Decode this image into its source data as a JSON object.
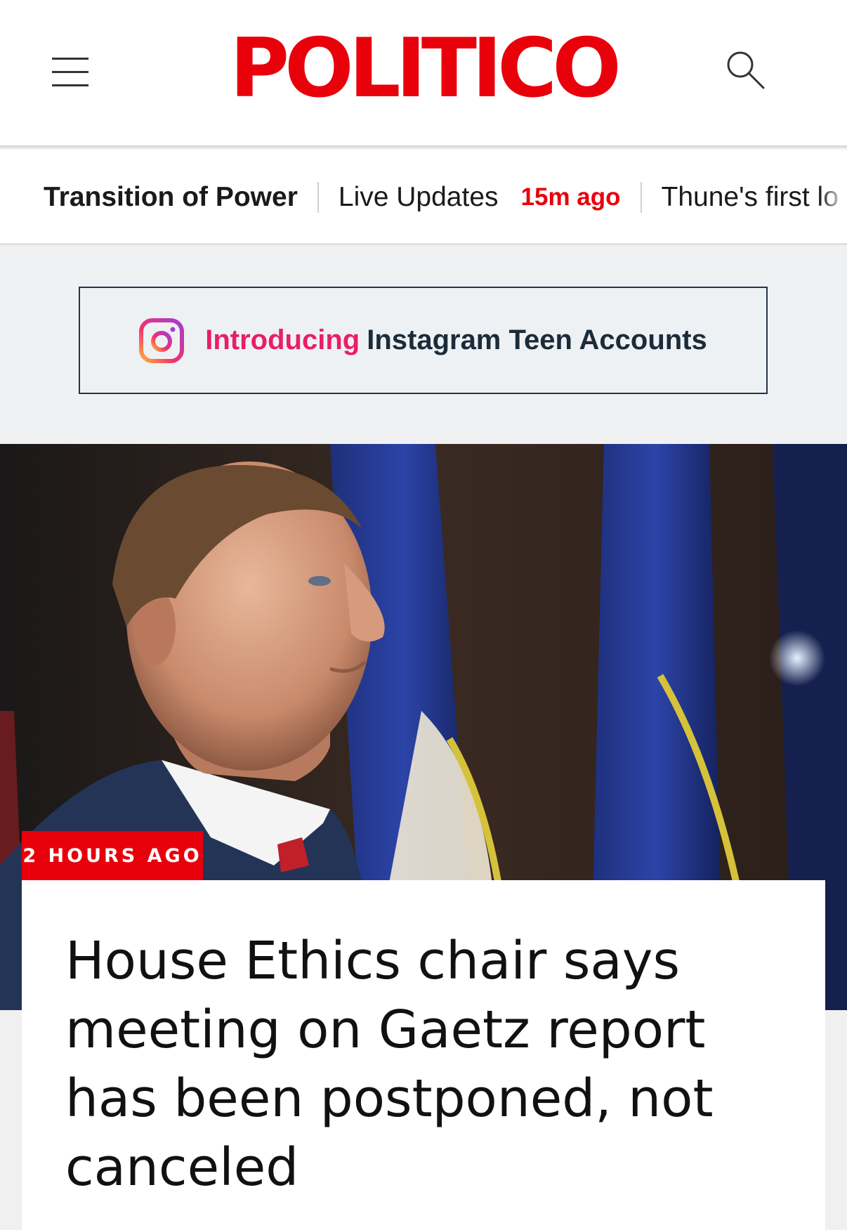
{
  "header": {
    "logo_text": "POLITICO",
    "menu_icon": "hamburger-menu-icon",
    "search_icon": "search-icon",
    "accent_color": "#e8000b"
  },
  "nav": {
    "items": [
      {
        "label": "Transition of Power"
      },
      {
        "label": "Live Updates",
        "time": "15m ago"
      },
      {
        "label": "Thune's first lo"
      }
    ]
  },
  "ad": {
    "icon": "instagram-icon",
    "intro": "Introducing",
    "text": "Instagram Teen Accounts"
  },
  "article": {
    "timestamp": "2 HOURS AGO",
    "headline": "House Ethics chair says meeting on Gaetz report has been postponed, not canceled",
    "image": "man-portrait-with-flags"
  }
}
